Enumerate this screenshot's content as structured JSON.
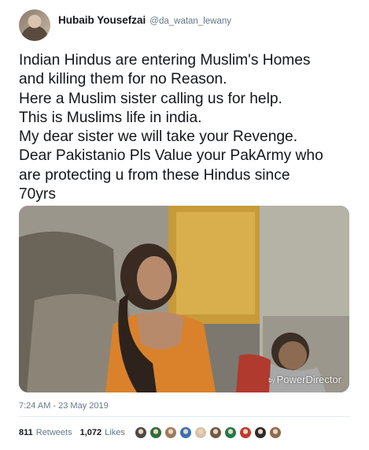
{
  "user": {
    "display_name": "Hubaib Yousefzai",
    "handle": "@da_watan_lewany"
  },
  "tweet": {
    "text": "Indian Hindus are entering Muslim's Homes\nand killing them for no Reason.\nHere a Muslim sister calling us for help.\nThis is Muslims life in india.\nMy dear sister we will take your Revenge.\nDear Pakistanio Pls Value your PakArmy who\nare protecting u from these Hindus since\n70yrs",
    "timestamp": "7:24 AM - 23 May 2019"
  },
  "media": {
    "watermark_prefix": "by",
    "watermark_brand": "PowerDirector"
  },
  "stats": {
    "retweets_count": "811",
    "retweets_label": "Retweets",
    "likes_count": "1,072",
    "likes_label": "Likes"
  },
  "likers": [
    {
      "icon": "liker-avatar-icon",
      "color": "#4a4a4a"
    },
    {
      "icon": "liker-avatar-icon",
      "color": "#2f6b3a"
    },
    {
      "icon": "liker-avatar-icon",
      "color": "#a07a5a"
    },
    {
      "icon": "liker-avatar-icon",
      "color": "#3a6fb0"
    },
    {
      "icon": "liker-avatar-icon",
      "color": "#d8c3a5"
    },
    {
      "icon": "liker-avatar-icon",
      "color": "#6e5a48"
    },
    {
      "icon": "liker-avatar-icon",
      "color": "#1f7a4a"
    },
    {
      "icon": "liker-avatar-icon",
      "color": "#c0392b"
    },
    {
      "icon": "liker-avatar-icon",
      "color": "#2c2c2c"
    },
    {
      "icon": "liker-avatar-icon",
      "color": "#8e6b4f"
    }
  ],
  "colors": {
    "primary_text": "#14171a",
    "secondary_text": "#657786",
    "divider": "#e6ecf0"
  }
}
